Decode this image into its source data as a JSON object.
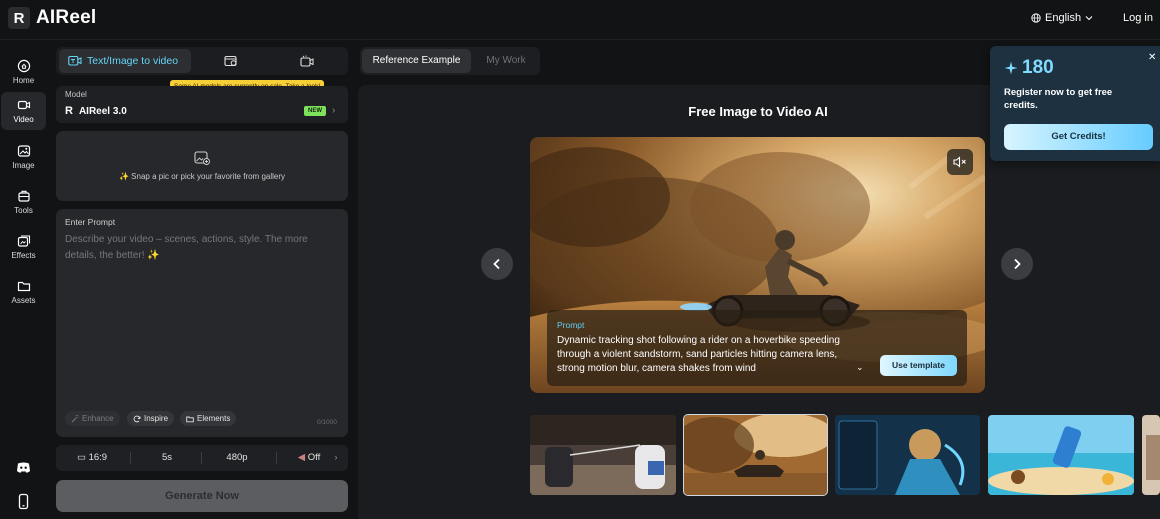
{
  "app": {
    "name": "AIReel",
    "logo_mark": "R",
    "brand_accent": "#66d4f4"
  },
  "header": {
    "language": "English",
    "language_icon": "globe-icon",
    "login": "Log in"
  },
  "sidebar": {
    "items": [
      {
        "label": "Home",
        "icon": "home-icon"
      },
      {
        "label": "Video",
        "icon": "video-icon",
        "active": true
      },
      {
        "label": "Image",
        "icon": "image-icon"
      },
      {
        "label": "Tools",
        "icon": "tools-icon"
      },
      {
        "label": "Effects",
        "icon": "effects-icon"
      },
      {
        "label": "Assets",
        "icon": "folder-icon"
      }
    ],
    "bottom_icons": [
      "discord-icon",
      "mobile-icon"
    ]
  },
  "creator": {
    "tabs": [
      {
        "label": "Text/Image to video",
        "icon": "text-image-video-icon",
        "active": true
      },
      {
        "label": "",
        "icon": "reference-video-icon"
      },
      {
        "label": "",
        "icon": "video-effects-icon"
      }
    ],
    "sale_tip": "Some AI models are currently on sale. Take a look!",
    "model": {
      "label": "Model",
      "name": "AIReel 3.0",
      "badge": "NEW"
    },
    "upload": {
      "text": "✨ Snap a pic or pick your favorite from gallery"
    },
    "prompt": {
      "label": "Enter Prompt",
      "placeholder": "Describe your video – scenes, actions, style. The more details, the better! ✨",
      "chips": [
        "Enhance",
        "Inspire",
        "Elements"
      ],
      "counter": "0/1000"
    },
    "settings": {
      "ratio": "16:9",
      "duration": "5s",
      "resolution": "480p",
      "sound": "Off"
    },
    "generate_label": "Generate Now"
  },
  "stage": {
    "tabs": [
      "Reference Example",
      "My Work"
    ],
    "title": "Free Image to Video AI",
    "overlay": {
      "label": "Prompt",
      "text": "Dynamic tracking shot following a rider on a hoverbike speeding through a violent sandstorm, sand particles hitting camera lens, strong motion blur, camera shakes from wind",
      "button": "Use template"
    },
    "thumbnails": [
      "samurai-cats",
      "hoverbike-sandstorm",
      "game-hero-card",
      "beach-drink"
    ],
    "selected_thumbnail": 1
  },
  "promo": {
    "credits": "180",
    "text": "Register now to get free credits.",
    "button": "Get Credits!"
  }
}
